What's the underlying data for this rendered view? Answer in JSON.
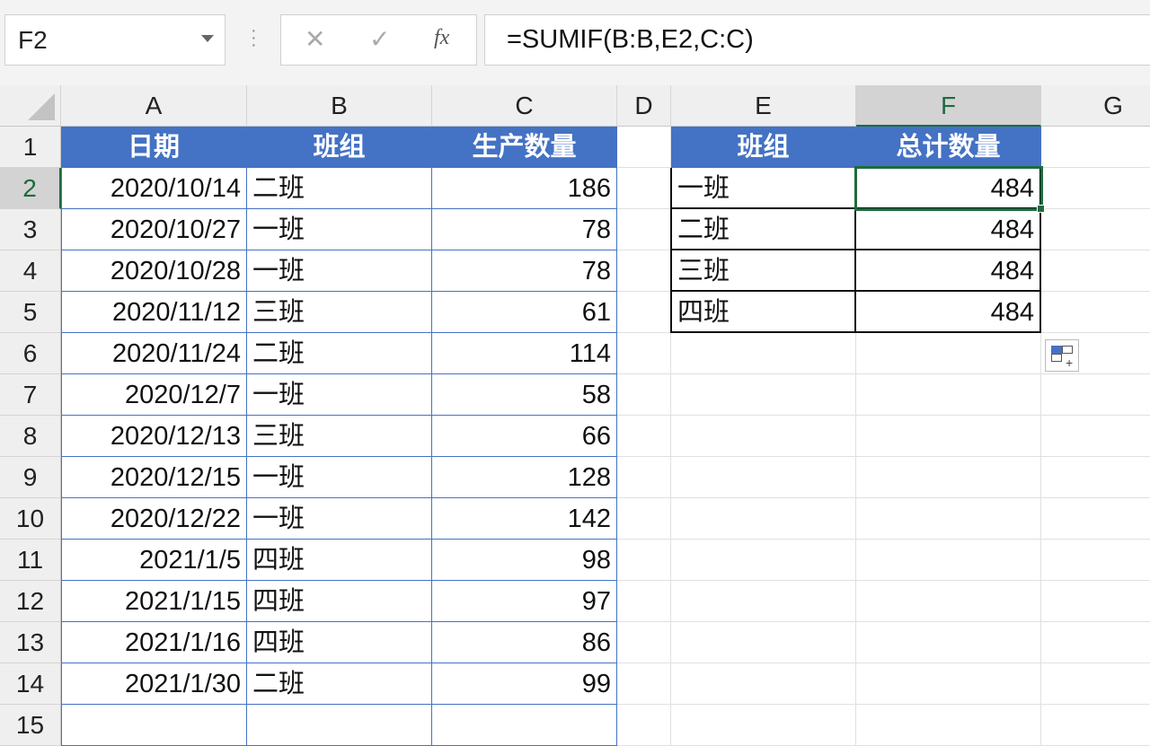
{
  "name_box": "F2",
  "formula": "=SUMIF(B:B,E2,C:C)",
  "fx_buttons": {
    "cancel": "✕",
    "enter": "✓",
    "fx": "fx"
  },
  "columns": [
    "A",
    "B",
    "C",
    "D",
    "E",
    "F",
    "G"
  ],
  "rows": [
    "1",
    "2",
    "3",
    "4",
    "5",
    "6",
    "7",
    "8",
    "9",
    "10",
    "11",
    "12",
    "13",
    "14",
    "15"
  ],
  "table1": {
    "headers": [
      "日期",
      "班组",
      "生产数量"
    ],
    "rows": [
      [
        "2020/10/14",
        "二班",
        "186"
      ],
      [
        "2020/10/27",
        "一班",
        "78"
      ],
      [
        "2020/10/28",
        "一班",
        "78"
      ],
      [
        "2020/11/12",
        "三班",
        "61"
      ],
      [
        "2020/11/24",
        "二班",
        "114"
      ],
      [
        "2020/12/7",
        "一班",
        "58"
      ],
      [
        "2020/12/13",
        "三班",
        "66"
      ],
      [
        "2020/12/15",
        "一班",
        "128"
      ],
      [
        "2020/12/22",
        "一班",
        "142"
      ],
      [
        "2021/1/5",
        "四班",
        "98"
      ],
      [
        "2021/1/15",
        "四班",
        "97"
      ],
      [
        "2021/1/16",
        "四班",
        "86"
      ],
      [
        "2021/1/30",
        "二班",
        "99"
      ]
    ]
  },
  "table2": {
    "headers": [
      "班组",
      "总计数量"
    ],
    "rows": [
      [
        "一班",
        "484"
      ],
      [
        "二班",
        "484"
      ],
      [
        "三班",
        "484"
      ],
      [
        "四班",
        "484"
      ]
    ]
  },
  "colors": {
    "header_blue": "#4472c4",
    "select_green": "#1e6b3f"
  }
}
